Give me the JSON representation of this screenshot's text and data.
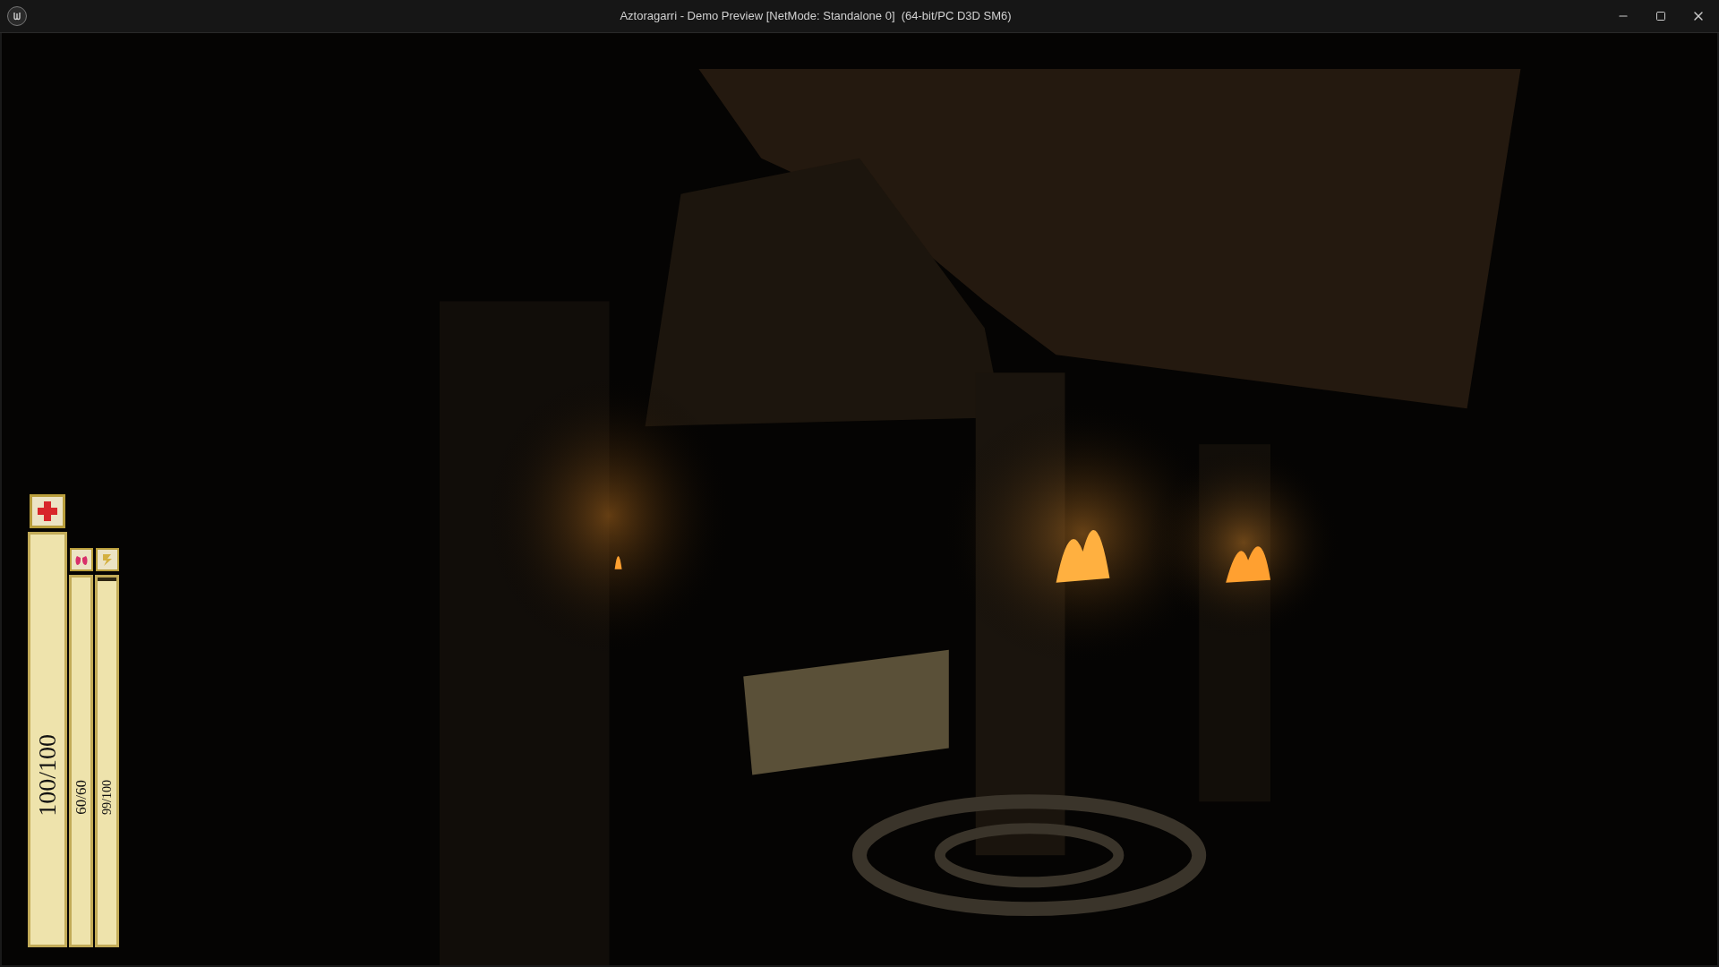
{
  "window": {
    "title": "Aztoragarri - Demo Preview [NetMode: Standalone 0]  (64-bit/PC D3D SM6)"
  },
  "hud": {
    "bars": [
      {
        "kind": "health",
        "reading": "100/100",
        "level": 1
      },
      {
        "kind": "breath",
        "reading": "60/60",
        "level": 1
      },
      {
        "kind": "stamina",
        "reading": "99/100",
        "level": 0.99
      }
    ]
  }
}
